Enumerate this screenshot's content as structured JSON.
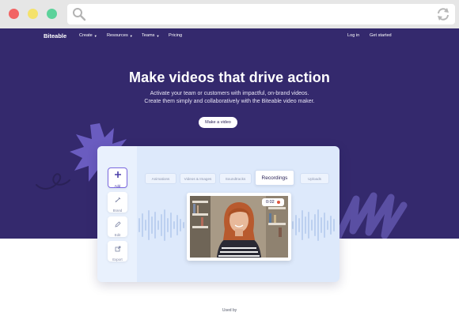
{
  "browser": {
    "window_controls": [
      "close",
      "minimize",
      "maximize"
    ],
    "url": ""
  },
  "nav": {
    "logo": "Biteable",
    "items": [
      {
        "label": "Create",
        "has_dropdown": true
      },
      {
        "label": "Resources",
        "has_dropdown": true
      },
      {
        "label": "Teams",
        "has_dropdown": true
      },
      {
        "label": "Pricing",
        "has_dropdown": false
      }
    ],
    "login": "Log in",
    "get_started": "Get started"
  },
  "hero": {
    "headline": "Make videos that drive action",
    "subline_1": "Activate your team or customers with impactful, on-brand videos.",
    "subline_2": "Create them simply and collaboratively with the Biteable video maker.",
    "cta": "Make a video"
  },
  "app": {
    "tools": [
      {
        "label": "Add",
        "icon": "plus-icon",
        "active": true
      },
      {
        "label": "Brand",
        "icon": "paint-drop-icon",
        "active": false
      },
      {
        "label": "Edit",
        "icon": "pencil-icon",
        "active": false
      },
      {
        "label": "Export",
        "icon": "export-icon",
        "active": false
      }
    ],
    "tabs": [
      {
        "label": "Animations",
        "active": false
      },
      {
        "label": "Videos & Images",
        "active": false
      },
      {
        "label": "Soundtracks",
        "active": false
      },
      {
        "label": "Recordings",
        "active": true
      },
      {
        "label": "Uploads",
        "active": false
      }
    ],
    "recording_time": "0:02"
  },
  "footer": {
    "used_by": "Used by"
  },
  "colors": {
    "hero_bg": "#34296d",
    "accent": "#7b69e0",
    "record": "#e0533d",
    "panel_bg": "#dde9fb"
  }
}
